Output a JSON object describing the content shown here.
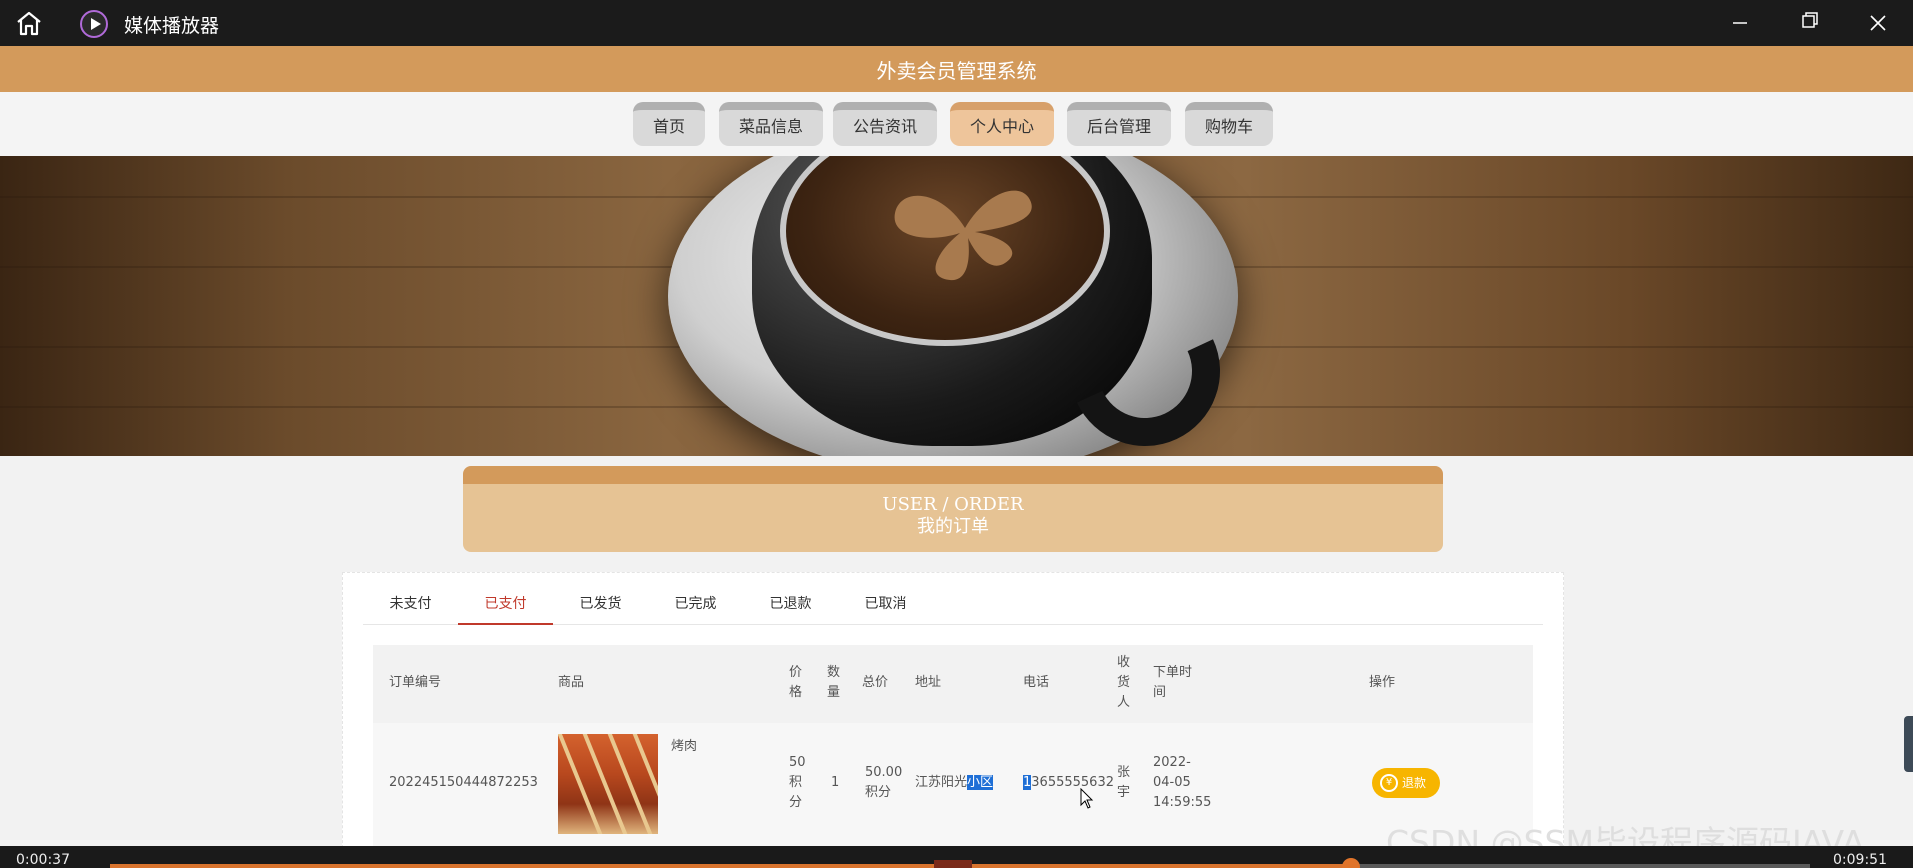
{
  "window": {
    "title": "媒体播放器",
    "icons": [
      "home-icon",
      "media-player-icon",
      "minimize-icon",
      "maximize-icon",
      "close-icon"
    ]
  },
  "site": {
    "title": "外卖会员管理系统"
  },
  "nav": {
    "items": [
      {
        "label": "首页",
        "active": false
      },
      {
        "label": "菜品信息",
        "active": false
      },
      {
        "label": "公告资讯",
        "active": false
      },
      {
        "label": "个人中心",
        "active": true
      },
      {
        "label": "后台管理",
        "active": false
      },
      {
        "label": "购物车",
        "active": false
      }
    ]
  },
  "section": {
    "title_en": "USER / ORDER",
    "title_cn": "我的订单"
  },
  "tabs": [
    {
      "label": "未支付",
      "active": false
    },
    {
      "label": "已支付",
      "active": true
    },
    {
      "label": "已发货",
      "active": false
    },
    {
      "label": "已完成",
      "active": false
    },
    {
      "label": "已退款",
      "active": false
    },
    {
      "label": "已取消",
      "active": false
    }
  ],
  "table": {
    "headers": {
      "order_no": "订单编号",
      "product": "商品",
      "price": [
        "价",
        "格"
      ],
      "qty": [
        "数",
        "量"
      ],
      "total": "总价",
      "address": "地址",
      "phone": "电话",
      "receiver": [
        "收",
        "货",
        "人"
      ],
      "order_time": [
        "下单时",
        "间"
      ],
      "action": "操作"
    },
    "rows": [
      {
        "order_no": "202245150444872253",
        "product_name": "烤肉",
        "price": [
          "50",
          "积",
          "分"
        ],
        "qty": "1",
        "total": [
          "50.00",
          "积分"
        ],
        "address_plain": "江苏阳光",
        "address_selected": "小区",
        "phone_selected": "1",
        "phone_plain": "3655555632",
        "receiver": [
          "张",
          "宇"
        ],
        "order_time": [
          "2022-",
          "04-05",
          "14:59:55"
        ],
        "action_label": "退款",
        "action_icon": "yen-icon"
      }
    ]
  },
  "watermark": "CSDN @SSM毕设程序源码JAVA",
  "player": {
    "time_elapsed": "0:00:37",
    "time_total": "0:09:51",
    "progress_fraction": 0.73,
    "accent": "#d9742e"
  },
  "colors": {
    "header": "#d39a5b",
    "nav_active": "#eec59b",
    "tab_active": "#c0392b",
    "refund_button": "#f7b500",
    "selection": "#1f6fd6"
  }
}
